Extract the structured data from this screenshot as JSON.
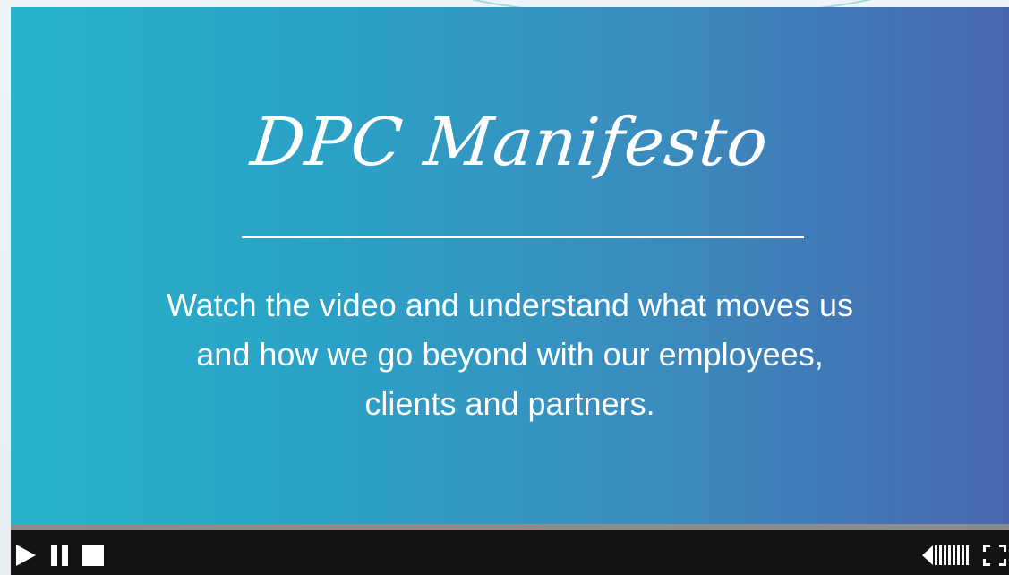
{
  "video": {
    "title": "DPC Manifesto",
    "subtitle": "Watch the video and understand what moves us and how we go beyond with our employees, clients and partners."
  },
  "controls": {
    "icons": [
      "play-icon",
      "pause-icon",
      "stop-icon",
      "volume-icon",
      "fullscreen-icon"
    ]
  },
  "colors": {
    "gradient_start": "#27b3cb",
    "gradient_end": "#4866ad",
    "control_bar": "#131313",
    "progress_track": "#8c8c8c"
  }
}
